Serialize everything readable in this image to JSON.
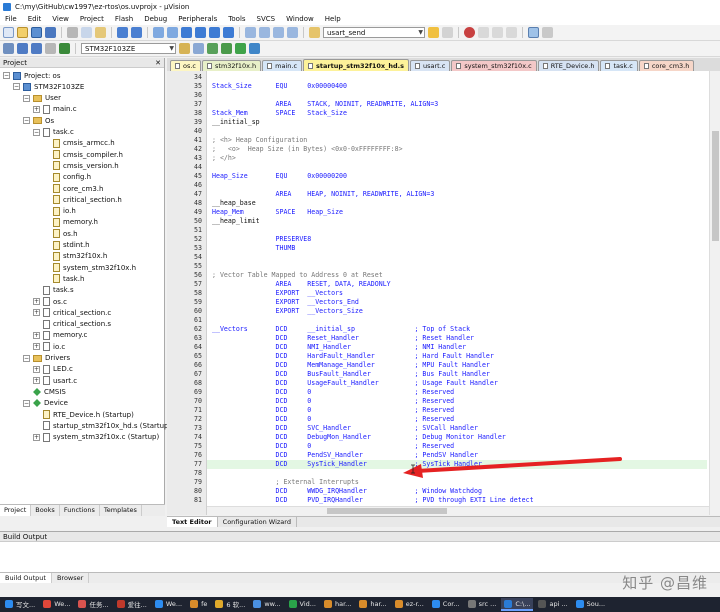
{
  "window": {
    "title": "C:\\my\\GitHub\\cw1997\\ez-rtos\\os.uvprojx - µVision"
  },
  "menu": [
    "File",
    "Edit",
    "View",
    "Project",
    "Flash",
    "Debug",
    "Peripherals",
    "Tools",
    "SVCS",
    "Window",
    "Help"
  ],
  "toolbar": {
    "target_combo": "usart_send",
    "target_name": "STM32F103ZE"
  },
  "project_panel": {
    "title": "Project",
    "nodes": [
      {
        "label": "Project: os",
        "indent": 0,
        "icon": "project-icon",
        "expander": "−"
      },
      {
        "label": "STM32F103ZE",
        "indent": 1,
        "icon": "target-icon",
        "expander": "−"
      },
      {
        "label": "User",
        "indent": 2,
        "icon": "folder-icon",
        "expander": "−"
      },
      {
        "label": "main.c",
        "indent": 3,
        "icon": "file-icon",
        "expander": "+"
      },
      {
        "label": "Os",
        "indent": 2,
        "icon": "folder-icon",
        "expander": "−"
      },
      {
        "label": "task.c",
        "indent": 3,
        "icon": "file-icon",
        "expander": "−"
      },
      {
        "label": "cmsis_armcc.h",
        "indent": 4,
        "icon": "header-file-icon",
        "expander": ""
      },
      {
        "label": "cmsis_compiler.h",
        "indent": 4,
        "icon": "header-file-icon",
        "expander": ""
      },
      {
        "label": "cmsis_version.h",
        "indent": 4,
        "icon": "header-file-icon",
        "expander": ""
      },
      {
        "label": "config.h",
        "indent": 4,
        "icon": "header-file-icon",
        "expander": ""
      },
      {
        "label": "core_cm3.h",
        "indent": 4,
        "icon": "header-file-icon",
        "expander": ""
      },
      {
        "label": "critical_section.h",
        "indent": 4,
        "icon": "header-file-icon",
        "expander": ""
      },
      {
        "label": "io.h",
        "indent": 4,
        "icon": "header-file-icon",
        "expander": ""
      },
      {
        "label": "memory.h",
        "indent": 4,
        "icon": "header-file-icon",
        "expander": ""
      },
      {
        "label": "os.h",
        "indent": 4,
        "icon": "header-file-icon",
        "expander": ""
      },
      {
        "label": "stdint.h",
        "indent": 4,
        "icon": "header-file-icon",
        "expander": ""
      },
      {
        "label": "stm32f10x.h",
        "indent": 4,
        "icon": "header-file-icon",
        "expander": ""
      },
      {
        "label": "system_stm32f10x.h",
        "indent": 4,
        "icon": "header-file-icon",
        "expander": ""
      },
      {
        "label": "task.h",
        "indent": 4,
        "icon": "header-file-icon",
        "expander": ""
      },
      {
        "label": "task.s",
        "indent": 3,
        "icon": "file-icon",
        "expander": ""
      },
      {
        "label": "os.c",
        "indent": 3,
        "icon": "file-icon",
        "expander": "+"
      },
      {
        "label": "critical_section.c",
        "indent": 3,
        "icon": "file-icon",
        "expander": "+"
      },
      {
        "label": "critical_section.s",
        "indent": 3,
        "icon": "file-icon",
        "expander": ""
      },
      {
        "label": "memory.c",
        "indent": 3,
        "icon": "file-icon",
        "expander": "+"
      },
      {
        "label": "io.c",
        "indent": 3,
        "icon": "file-icon",
        "expander": "+"
      },
      {
        "label": "Drivers",
        "indent": 2,
        "icon": "folder-icon",
        "expander": "−"
      },
      {
        "label": "LED.c",
        "indent": 3,
        "icon": "file-icon",
        "expander": "+"
      },
      {
        "label": "usart.c",
        "indent": 3,
        "icon": "file-icon",
        "expander": "+"
      },
      {
        "label": "CMSIS",
        "indent": 2,
        "icon": "gem-icon",
        "expander": ""
      },
      {
        "label": "Device",
        "indent": 2,
        "icon": "gem-icon",
        "expander": "−"
      },
      {
        "label": "RTE_Device.h (Startup)",
        "indent": 3,
        "icon": "header-file-icon",
        "expander": ""
      },
      {
        "label": "startup_stm32f10x_hd.s (Startup)",
        "indent": 3,
        "icon": "file-icon",
        "expander": ""
      },
      {
        "label": "system_stm32f10x.c (Startup)",
        "indent": 3,
        "icon": "file-icon",
        "expander": "+"
      }
    ],
    "tabs": [
      "Project",
      "Books",
      "Functions",
      "Templates"
    ]
  },
  "editor_tabs": [
    {
      "label": "os.c",
      "color": "#fdf6c3",
      "active": false
    },
    {
      "label": "stm32f10x.h",
      "color": "#e8f0c8",
      "active": false
    },
    {
      "label": "main.c",
      "color": "#d6e6f7",
      "active": false
    },
    {
      "label": "startup_stm32f10x_hd.s",
      "color": "#fdf29a",
      "active": true
    },
    {
      "label": "usart.c",
      "color": "#d8e4f4",
      "active": false
    },
    {
      "label": "system_stm32f10x.c",
      "color": "#f3c8c8",
      "active": false
    },
    {
      "label": "RTE_Device.h",
      "color": "#d6e2f2",
      "active": false
    },
    {
      "label": "task.c",
      "color": "#d6e6f7",
      "active": false
    },
    {
      "label": "core_cm3.h",
      "color": "#f6d6c8",
      "active": false
    }
  ],
  "code_lines": [
    {
      "n": "34",
      "t": "",
      "cls": ""
    },
    {
      "n": "35",
      "t": "Stack_Size      EQU     0x00000400",
      "cls": "mix"
    },
    {
      "n": "36",
      "t": "",
      "cls": ""
    },
    {
      "n": "37",
      "t": "                AREA    STACK, NOINIT, READWRITE, ALIGN=3",
      "cls": "k"
    },
    {
      "n": "38",
      "t": "Stack_Mem       SPACE   Stack_Size",
      "cls": "mix"
    },
    {
      "n": "39",
      "t": "__initial_sp",
      "cls": ""
    },
    {
      "n": "40",
      "t": "",
      "cls": ""
    },
    {
      "n": "41",
      "t": "; <h> Heap Configuration",
      "cls": "c"
    },
    {
      "n": "42",
      "t": ";   <o>  Heap Size (in Bytes) <0x0-0xFFFFFFFF:8>",
      "cls": "c"
    },
    {
      "n": "43",
      "t": "; </h>",
      "cls": "c"
    },
    {
      "n": "44",
      "t": "",
      "cls": ""
    },
    {
      "n": "45",
      "t": "Heap_Size       EQU     0x00000200",
      "cls": "mix"
    },
    {
      "n": "46",
      "t": "",
      "cls": ""
    },
    {
      "n": "47",
      "t": "                AREA    HEAP, NOINIT, READWRITE, ALIGN=3",
      "cls": "k"
    },
    {
      "n": "48",
      "t": "__heap_base",
      "cls": ""
    },
    {
      "n": "49",
      "t": "Heap_Mem        SPACE   Heap_Size",
      "cls": "mix"
    },
    {
      "n": "50",
      "t": "__heap_limit",
      "cls": ""
    },
    {
      "n": "51",
      "t": "",
      "cls": ""
    },
    {
      "n": "52",
      "t": "                PRESERVE8",
      "cls": "k"
    },
    {
      "n": "53",
      "t": "                THUMB",
      "cls": "k"
    },
    {
      "n": "54",
      "t": "",
      "cls": ""
    },
    {
      "n": "55",
      "t": "",
      "cls": ""
    },
    {
      "n": "56",
      "t": "; Vector Table Mapped to Address 0 at Reset",
      "cls": "c"
    },
    {
      "n": "57",
      "t": "                AREA    RESET, DATA, READONLY",
      "cls": "k"
    },
    {
      "n": "58",
      "t": "                EXPORT  __Vectors",
      "cls": "k"
    },
    {
      "n": "59",
      "t": "                EXPORT  __Vectors_End",
      "cls": "k"
    },
    {
      "n": "60",
      "t": "                EXPORT  __Vectors_Size",
      "cls": "k"
    },
    {
      "n": "61",
      "t": "",
      "cls": ""
    },
    {
      "n": "62",
      "t": "__Vectors       DCD     __initial_sp               ; Top of Stack",
      "cls": "mix"
    },
    {
      "n": "63",
      "t": "                DCD     Reset_Handler              ; Reset Handler",
      "cls": "mix"
    },
    {
      "n": "64",
      "t": "                DCD     NMI_Handler                ; NMI Handler",
      "cls": "mix"
    },
    {
      "n": "65",
      "t": "                DCD     HardFault_Handler          ; Hard Fault Handler",
      "cls": "mix"
    },
    {
      "n": "66",
      "t": "                DCD     MemManage_Handler          ; MPU Fault Handler",
      "cls": "mix"
    },
    {
      "n": "67",
      "t": "                DCD     BusFault_Handler           ; Bus Fault Handler",
      "cls": "mix"
    },
    {
      "n": "68",
      "t": "                DCD     UsageFault_Handler         ; Usage Fault Handler",
      "cls": "mix"
    },
    {
      "n": "69",
      "t": "                DCD     0                          ; Reserved",
      "cls": "zero"
    },
    {
      "n": "70",
      "t": "                DCD     0                          ; Reserved",
      "cls": "zero"
    },
    {
      "n": "71",
      "t": "                DCD     0                          ; Reserved",
      "cls": "zero"
    },
    {
      "n": "72",
      "t": "                DCD     0                          ; Reserved",
      "cls": "zero"
    },
    {
      "n": "73",
      "t": "                DCD     SVC_Handler                ; SVCall Handler",
      "cls": "mix"
    },
    {
      "n": "74",
      "t": "                DCD     DebugMon_Handler           ; Debug Monitor Handler",
      "cls": "mix"
    },
    {
      "n": "75",
      "t": "                DCD     0                          ; Reserved",
      "cls": "zero"
    },
    {
      "n": "76",
      "t": "                DCD     PendSV_Handler             ; PendSV Handler",
      "cls": "mix"
    },
    {
      "n": "77",
      "t": "                DCD     SysTick_Handler            ; SysTick Handler",
      "cls": "mix hl"
    },
    {
      "n": "78",
      "t": "",
      "cls": ""
    },
    {
      "n": "79",
      "t": "                ; External Interrupts",
      "cls": "c"
    },
    {
      "n": "80",
      "t": "                DCD     WWDG_IRQHandler            ; Window Watchdog",
      "cls": "mix"
    },
    {
      "n": "81",
      "t": "                DCD     PVD_IRQHandler             ; PVD through EXTI Line detect",
      "cls": "mix"
    }
  ],
  "editor_bottom_tabs": [
    "Text Editor",
    "Configuration Wizard"
  ],
  "build_output": {
    "title": "Build Output",
    "tabs": [
      "Build Output",
      "Browser"
    ]
  },
  "watermark": "知乎 @昌维",
  "taskbar": [
    {
      "label": "写文...",
      "color": "#2d8cf0"
    },
    {
      "label": "We...",
      "color": "#e0473a"
    },
    {
      "label": "任务...",
      "color": "#d9534f"
    },
    {
      "label": "爱往...",
      "color": "#c0392b"
    },
    {
      "label": "We...",
      "color": "#2d8cf0"
    },
    {
      "label": "fe",
      "color": "#d98c2b"
    },
    {
      "label": "6 软...",
      "color": "#e0a92b"
    },
    {
      "label": "ww...",
      "color": "#4a90e2"
    },
    {
      "label": "Vid...",
      "color": "#2aa34a"
    },
    {
      "label": "har...",
      "color": "#d98c2b"
    },
    {
      "label": "har...",
      "color": "#d98c2b"
    },
    {
      "label": "ez-r...",
      "color": "#d98c2b"
    },
    {
      "label": "Cor...",
      "color": "#2d8cf0"
    },
    {
      "label": "src ...",
      "color": "#777"
    },
    {
      "label": "C:\\...",
      "color": "#2a7bd6",
      "active": true
    },
    {
      "label": "api ...",
      "color": "#555"
    },
    {
      "label": "Sou...",
      "color": "#2d8cf0"
    }
  ],
  "colors": {
    "keyword": "#1a1aff",
    "number": "#c00000",
    "comment": "#777777",
    "highlight": "#e3f7e3",
    "arrow": "#e52222"
  }
}
